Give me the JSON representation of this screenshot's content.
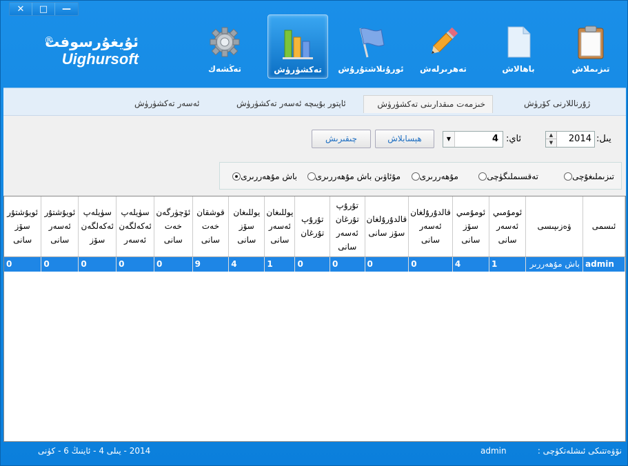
{
  "window": {
    "controls": [
      "✕",
      "□",
      "—"
    ]
  },
  "logo": {
    "uyghur": "ئۇيغۇرسوفت",
    "reg": "®",
    "english": "Uighursoft"
  },
  "toolbar": [
    {
      "label": "تەڭشەك",
      "icon": "gear-icon"
    },
    {
      "label": "تەكشۈرۈش",
      "icon": "bar-chart-icon"
    },
    {
      "label": "ئورۇنلاشتۇرۇش",
      "icon": "flag-icon"
    },
    {
      "label": "تەھرىرلەش",
      "icon": "pencil-icon"
    },
    {
      "label": "باھالاش",
      "icon": "document-icon"
    },
    {
      "label": "تىزىملاش",
      "icon": "clipboard-icon"
    }
  ],
  "subtabs": [
    "ژۇرناللارنى كۆرۈش",
    "خىزمەت مىقدارىنى تەكشۈرۈش",
    "ئاپتور بۇيىچە ئەسەر تەكشۈرۈش",
    "ئەسەر تەكشۈرۈش"
  ],
  "filter": {
    "year_label": "يىل:",
    "year_value": "2014",
    "month_label": "ئاي:",
    "month_value": "4",
    "calc_button": "ھېسابلاش",
    "export_button": "چىقىرىش"
  },
  "roles": [
    {
      "label": "تىزىملىغۇچى",
      "checked": false
    },
    {
      "label": "تەقسىملىگۈچى",
      "checked": false
    },
    {
      "label": "مۇھەررىرى",
      "checked": false
    },
    {
      "label": "مۇئاۋىن باش مۇھەررىرى",
      "checked": false
    },
    {
      "label": "باش مۇھەررىرى",
      "checked": true
    }
  ],
  "table": {
    "headers": [
      "ئىسمى",
      "ۋەزىپىسى",
      "ئومۇمىي ئەسەر سانى",
      "ئومۇمىي سۆز سانى",
      "قالدۇرۇلغان ئەسەر سانى",
      "قالدۇرۇلغان سۆز سانى",
      "تۇرۇپ تۇرغان ئەسەر سانى",
      "تۇرۇپ تۇرغان",
      "يوللىغان ئەسەر سانى",
      "يوللىغان سۆز سانى",
      "قوشقان خەت سانى",
      "ئۆچۈرگەن خەت سانى",
      "سۈيلەپ ئەكەلگەن ئەسەر",
      "سۈيلەپ ئەكەلگەن سۆز",
      "ئويۇشتۇر ئەسەر سانى",
      "ئويۇشتۇر سۆز سانى"
    ],
    "rows": [
      {
        "name": "admin",
        "role": "باش مۇھەررىر",
        "values": [
          "1",
          "4",
          "0",
          "0",
          "0",
          "0",
          "1",
          "4",
          "9",
          "0",
          "0",
          "0",
          "0",
          "0"
        ]
      }
    ]
  },
  "status": {
    "operator_label": "نۆۋەتتىكى ئىشلەتكۈچى :",
    "operator_value": "admin",
    "date": "2014 - يىلى 4 - ئاينىڭ 6 - كۈنى"
  }
}
